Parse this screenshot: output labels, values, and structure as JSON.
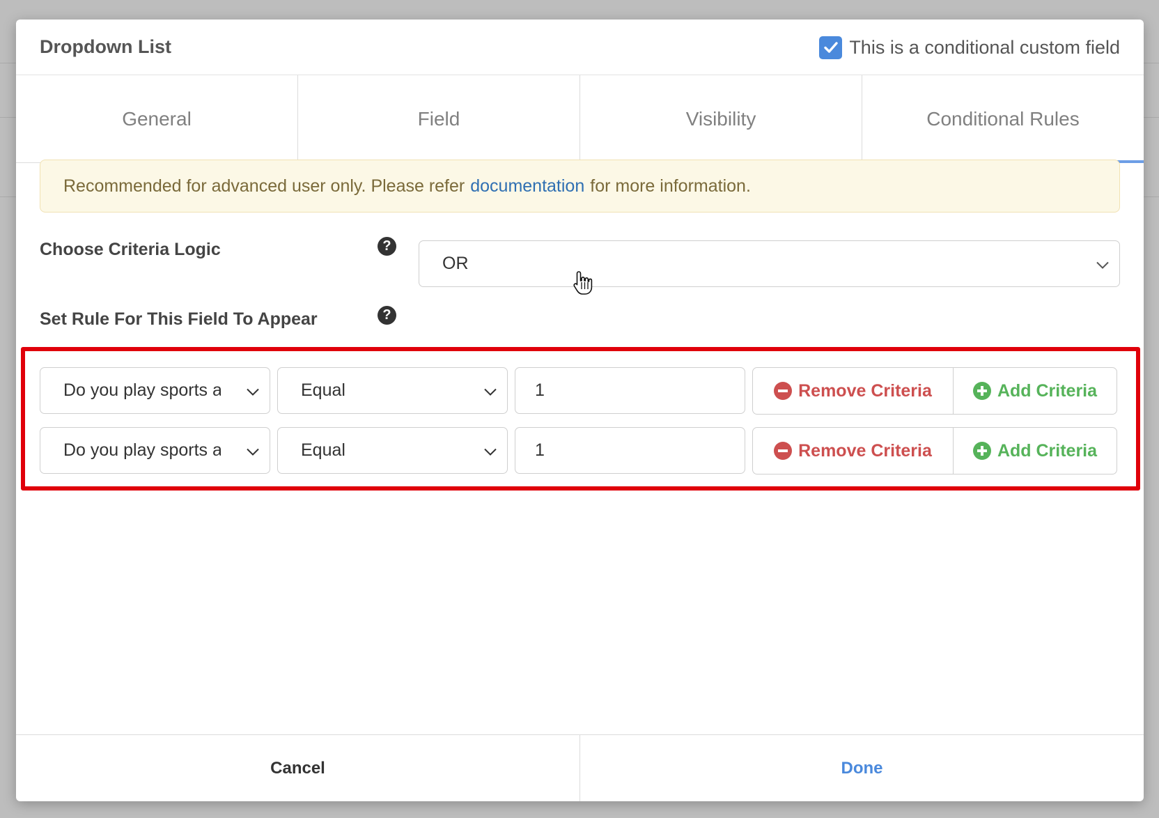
{
  "modal": {
    "title": "Dropdown List",
    "conditional_checkbox": {
      "label": "This is a conditional custom field",
      "checked": true
    }
  },
  "tabs": [
    {
      "label": "General",
      "active": false
    },
    {
      "label": "Field",
      "active": false
    },
    {
      "label": "Visibility",
      "active": false
    },
    {
      "label": "Conditional Rules",
      "active": true
    }
  ],
  "notice": {
    "text_before": "Recommended for advanced user only. Please refer",
    "link_text": "documentation",
    "text_after": "for more information."
  },
  "criteria_logic": {
    "label": "Choose Criteria Logic",
    "value": "OR"
  },
  "rules": {
    "label": "Set Rule For This Field To Appear",
    "rows": [
      {
        "field": "Do you play sports as",
        "operator": "Equal",
        "value": "1",
        "remove_label": "Remove Criteria",
        "add_label": "Add Criteria"
      },
      {
        "field": "Do you play sports as",
        "operator": "Equal",
        "value": "1",
        "remove_label": "Remove Criteria",
        "add_label": "Add Criteria"
      }
    ]
  },
  "footer": {
    "cancel_label": "Cancel",
    "done_label": "Done"
  },
  "colors": {
    "accent": "#4a89dc",
    "remove": "#cd4f4f",
    "add": "#56b35a",
    "highlight": "#e0000a"
  }
}
